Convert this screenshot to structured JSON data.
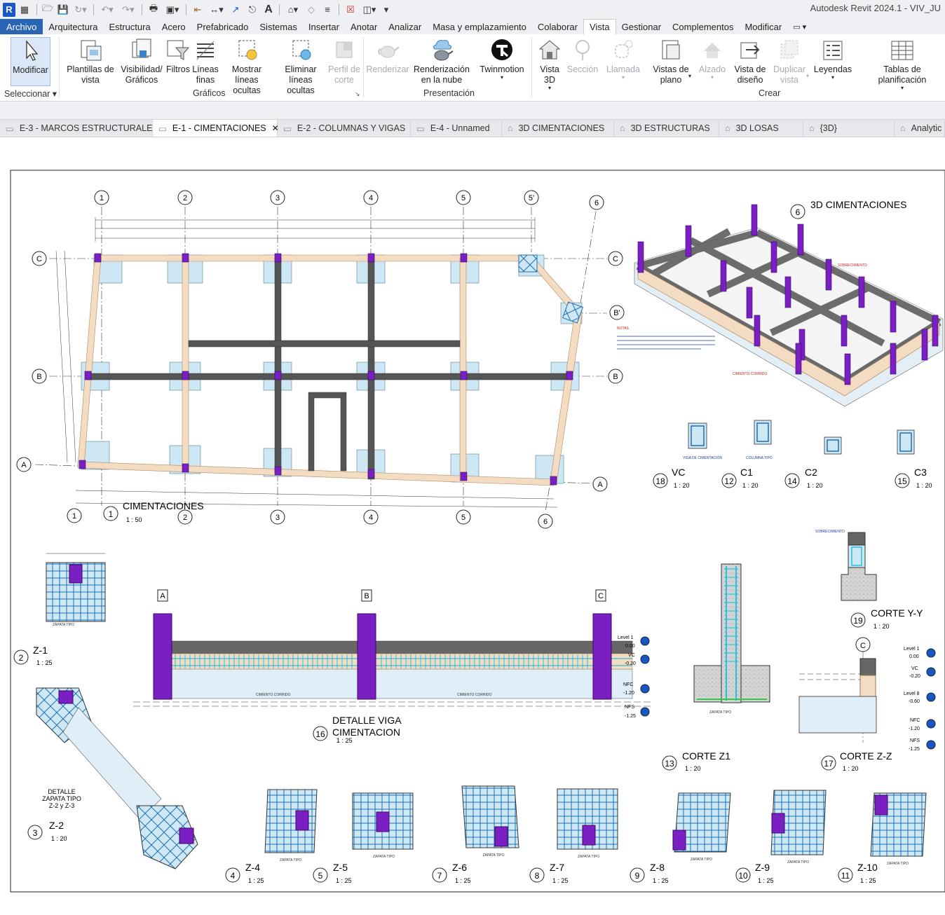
{
  "app": {
    "title": "Autodesk Revit 2024.1 - VIV_JU",
    "logo_letter": "R"
  },
  "menu": {
    "file": "Archivo",
    "tabs": [
      "Arquitectura",
      "Estructura",
      "Acero",
      "Prefabricado",
      "Sistemas",
      "Insertar",
      "Anotar",
      "Analizar",
      "Masa y emplazamiento",
      "Colaborar",
      "Vista",
      "Gestionar",
      "Complementos",
      "Modificar"
    ],
    "active_index": 10
  },
  "ribbon": {
    "modify": "Modificar",
    "select_panel": "Seleccionar",
    "graphics_panel": "Gráficos",
    "presentation_panel": "Presentación",
    "create_panel": "Crear",
    "buttons": {
      "view_templates": [
        "Plantillas de",
        "vista"
      ],
      "visibility": [
        "Visibilidad/",
        "Gráficos"
      ],
      "filters": [
        "Filtros"
      ],
      "thin_lines": [
        "Líneas",
        "finas"
      ],
      "show_hidden": [
        "Mostrar",
        "líneas ocultas"
      ],
      "remove_hidden": [
        "Eliminar",
        "líneas ocultas"
      ],
      "cut_profile": [
        "Perfil de",
        "corte"
      ],
      "render": [
        "Renderizar"
      ],
      "cloud_render": [
        "Renderización",
        "en la nube"
      ],
      "twinmotion": [
        "Twinmotion"
      ],
      "view_3d": [
        "Vista",
        "3D"
      ],
      "section": [
        "Sección"
      ],
      "callout": [
        "Llamada"
      ],
      "plan_views": [
        "Vistas de",
        "plano"
      ],
      "elevation": [
        "Alzado"
      ],
      "drafting_view": [
        "Vista de",
        "diseño"
      ],
      "duplicate_view": [
        "Duplicar",
        "vista"
      ],
      "legends": [
        "Leyendas"
      ],
      "schedules": [
        "Tablas de planificación"
      ]
    }
  },
  "view_tabs": [
    {
      "label": "E-3 - MARCOS ESTRUCTURALES",
      "kind": "sheet"
    },
    {
      "label": "E-1 - CIMENTACIONES",
      "kind": "sheet",
      "active": true
    },
    {
      "label": "E-2 - COLUMNAS Y VIGAS",
      "kind": "sheet"
    },
    {
      "label": "E-4 - Unnamed",
      "kind": "sheet"
    },
    {
      "label": "3D CIMENTACIONES",
      "kind": "3d"
    },
    {
      "label": "3D ESTRUCTURAS",
      "kind": "3d"
    },
    {
      "label": "3D LOSAS",
      "kind": "3d"
    },
    {
      "label": "{3D}",
      "kind": "3d"
    },
    {
      "label": "Analytic",
      "kind": "3d"
    }
  ],
  "drawing": {
    "grid_numbers": [
      "1",
      "2",
      "3",
      "4",
      "5",
      "5'",
      "6"
    ],
    "grid_letters": [
      "A",
      "B",
      "B'",
      "C"
    ],
    "plan": {
      "number": "1",
      "title": "CIMENTACIONES",
      "scale": "1 : 50"
    },
    "iso": {
      "number": "6",
      "title": "3D CIMENTACIONES"
    },
    "columns": [
      {
        "number": "18",
        "title": "VC",
        "scale": "1 : 20"
      },
      {
        "number": "12",
        "title": "C1",
        "scale": "1 : 20"
      },
      {
        "number": "14",
        "title": "C2",
        "scale": "1 : 20"
      },
      {
        "number": "15",
        "title": "C3",
        "scale": "1 : 20"
      }
    ],
    "detail_beam": {
      "number": "16",
      "title": "DETALLE VIGA",
      "title2": "CIMENTACION",
      "scale": "1 : 25"
    },
    "corte_yy": {
      "number": "19",
      "title": "CORTE Y-Y",
      "scale": "1 : 20"
    },
    "corte_z1": {
      "number": "13",
      "title": "CORTE Z1",
      "scale": "1 : 20"
    },
    "corte_zz": {
      "number": "17",
      "title": "CORTE Z-Z",
      "scale": "1 : 20"
    },
    "z1": {
      "number": "2",
      "title": "Z-1",
      "scale": "1 : 25"
    },
    "z2": {
      "number": "3",
      "title": "Z-2",
      "scale": "1 : 20"
    },
    "z2_detail": [
      "DETALLE",
      "ZAPATA TIPO",
      "Z-2 y Z-3"
    ],
    "footings": [
      {
        "number": "4",
        "title": "Z-4",
        "scale": "1 : 25"
      },
      {
        "number": "5",
        "title": "Z-5",
        "scale": "1 : 25"
      },
      {
        "number": "7",
        "title": "Z-6",
        "scale": "1 : 25"
      },
      {
        "number": "8",
        "title": "Z-7",
        "scale": "1 : 25"
      },
      {
        "number": "9",
        "title": "Z-8",
        "scale": "1 : 25"
      },
      {
        "number": "10",
        "title": "Z-9",
        "scale": "1 : 25"
      },
      {
        "number": "11",
        "title": "Z-10",
        "scale": "1 : 25"
      }
    ],
    "levels": [
      "Level 1",
      "0.00",
      "VC",
      "-0.20",
      "NFC",
      "-1.20",
      "NFS",
      "-1.25",
      "Level 8",
      "-0.60"
    ],
    "small_text": {
      "zapata_tipo": "ZAPATA TIPO",
      "cimiento_corrido": "CIMIENTO CORRIDO",
      "sobrecimiento": "SOBRECIMIENTO",
      "columna_tipo": "COLUMNA TIPO",
      "viga_cimentacion": "VIGA DE CIMENTACIÓN",
      "notas": "NOTAS"
    },
    "colors": {
      "column": "#7a1fc2",
      "beam_dark": "#555555",
      "beam_light": "#f3dcc2",
      "footing": "#cde7f5",
      "rebar": "#1f6fb0",
      "red_text": "#c81e1e"
    }
  }
}
